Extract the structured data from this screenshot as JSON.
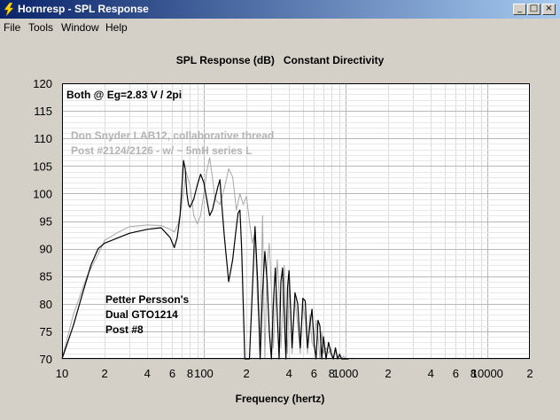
{
  "window": {
    "title": "Hornresp - SPL Response",
    "minimize_glyph": "_",
    "maximize_glyph": "□",
    "close_glyph": "×"
  },
  "menu": {
    "items": [
      "File",
      "Tools",
      "Window",
      "Help"
    ]
  },
  "chart_data": {
    "type": "line",
    "title": "SPL Response (dB)   Constant Directivity",
    "xlabel": "Frequency (hertz)",
    "ylabel": "",
    "xscale": "log",
    "xlim": [
      10,
      20000
    ],
    "ylim": [
      70,
      120
    ],
    "grid": true,
    "y_ticks": [
      70,
      75,
      80,
      85,
      90,
      95,
      100,
      105,
      110,
      115,
      120
    ],
    "x_ticks": [
      {
        "value": 10,
        "label": "10"
      },
      {
        "value": 20,
        "label": "2"
      },
      {
        "value": 40,
        "label": "4"
      },
      {
        "value": 60,
        "label": "6"
      },
      {
        "value": 80,
        "label": "8"
      },
      {
        "value": 100,
        "label": "100"
      },
      {
        "value": 200,
        "label": "2"
      },
      {
        "value": 400,
        "label": "4"
      },
      {
        "value": 600,
        "label": "6"
      },
      {
        "value": 800,
        "label": "8"
      },
      {
        "value": 1000,
        "label": "1000"
      },
      {
        "value": 2000,
        "label": "2"
      },
      {
        "value": 4000,
        "label": "4"
      },
      {
        "value": 6000,
        "label": "6"
      },
      {
        "value": 8000,
        "label": "8"
      },
      {
        "value": 10000,
        "label": "10000"
      },
      {
        "value": 20000,
        "label": "2"
      }
    ],
    "annotations": {
      "top_left": "Both @  Eg=2.83 V / 2pi",
      "gray_line1": "Don Snyder LAB12, collaborative thread",
      "gray_line2": "Post #2124/2126 - w/ ~ 5mH series L",
      "black_line1": "Petter Persson's",
      "black_line2": "Dual GTO1214",
      "black_line3": "Post #8"
    },
    "series": [
      {
        "color": "#000000",
        "x": [
          10,
          12,
          14,
          16,
          18,
          20,
          25,
          30,
          40,
          50,
          58,
          62,
          65,
          68,
          70,
          72,
          74,
          76,
          78,
          80,
          85,
          90,
          95,
          100,
          105,
          110,
          115,
          120,
          125,
          130,
          135,
          140,
          150,
          160,
          170,
          175,
          180,
          185,
          190,
          195,
          200,
          205,
          210,
          220,
          230,
          240,
          250,
          260,
          270,
          280,
          290,
          300,
          310,
          320,
          330,
          340,
          350,
          360,
          370,
          380,
          390,
          400,
          410,
          420,
          440,
          460,
          480,
          500,
          520,
          540,
          560,
          580,
          600,
          620,
          640,
          660,
          680,
          700,
          730,
          760,
          790,
          820,
          850,
          880,
          910,
          940,
          970,
          1000,
          1050
        ],
        "values": [
          70,
          76,
          82,
          87,
          90,
          91,
          92,
          92.8,
          93.5,
          93.8,
          92,
          90.2,
          92,
          96,
          101,
          106,
          104.5,
          100,
          98,
          97.5,
          99,
          101.5,
          103.5,
          102,
          99,
          96,
          97,
          99,
          101,
          102.5,
          97,
          92,
          84,
          88,
          94,
          96.5,
          97,
          90,
          80,
          70,
          70,
          70,
          70,
          82,
          94,
          84,
          70,
          82,
          89.5,
          84,
          75,
          70,
          80,
          86.5,
          78,
          70,
          84,
          86.5,
          78,
          70,
          83,
          86,
          79,
          72,
          82,
          80,
          72,
          81,
          80.5,
          72,
          76,
          79,
          73,
          70,
          77,
          76,
          70,
          74,
          70,
          73,
          71,
          70,
          72,
          70,
          70.8,
          70,
          70,
          70,
          70
        ]
      },
      {
        "color": "#a8a8a8",
        "x": [
          10,
          12,
          15,
          18,
          20,
          25,
          30,
          40,
          50,
          58,
          62,
          66,
          70,
          75,
          80,
          85,
          90,
          95,
          100,
          105,
          110,
          115,
          120,
          130,
          140,
          150,
          160,
          170,
          180,
          190,
          200,
          210,
          220,
          230,
          240,
          250,
          260,
          270,
          280,
          290,
          300,
          310,
          320,
          330,
          340,
          350,
          360,
          370,
          380,
          390,
          400,
          410,
          420,
          440,
          460,
          480,
          500,
          520,
          540,
          560,
          580,
          600,
          620,
          640,
          660,
          680,
          700,
          730,
          760,
          790,
          820,
          850,
          880,
          910,
          940,
          970,
          1000,
          1050
        ],
        "values": [
          70,
          78,
          85,
          89,
          91.5,
          93,
          94,
          94.3,
          94.2,
          93.5,
          93,
          94.5,
          98,
          104,
          101.5,
          96,
          94.5,
          96,
          100,
          104,
          106.5,
          103,
          99,
          98,
          101,
          104.5,
          103,
          97,
          100,
          98,
          99.5,
          95,
          91,
          93,
          80,
          74,
          96,
          70,
          87,
          91,
          83,
          72,
          80,
          88,
          82,
          72,
          79,
          87,
          76,
          71,
          84,
          79,
          71,
          81,
          76,
          71,
          80,
          77,
          71,
          78,
          73,
          72,
          77,
          74,
          70,
          75,
          71,
          72,
          71,
          72,
          70,
          71.5,
          70,
          71,
          70,
          70.5,
          70,
          70
        ]
      }
    ]
  }
}
